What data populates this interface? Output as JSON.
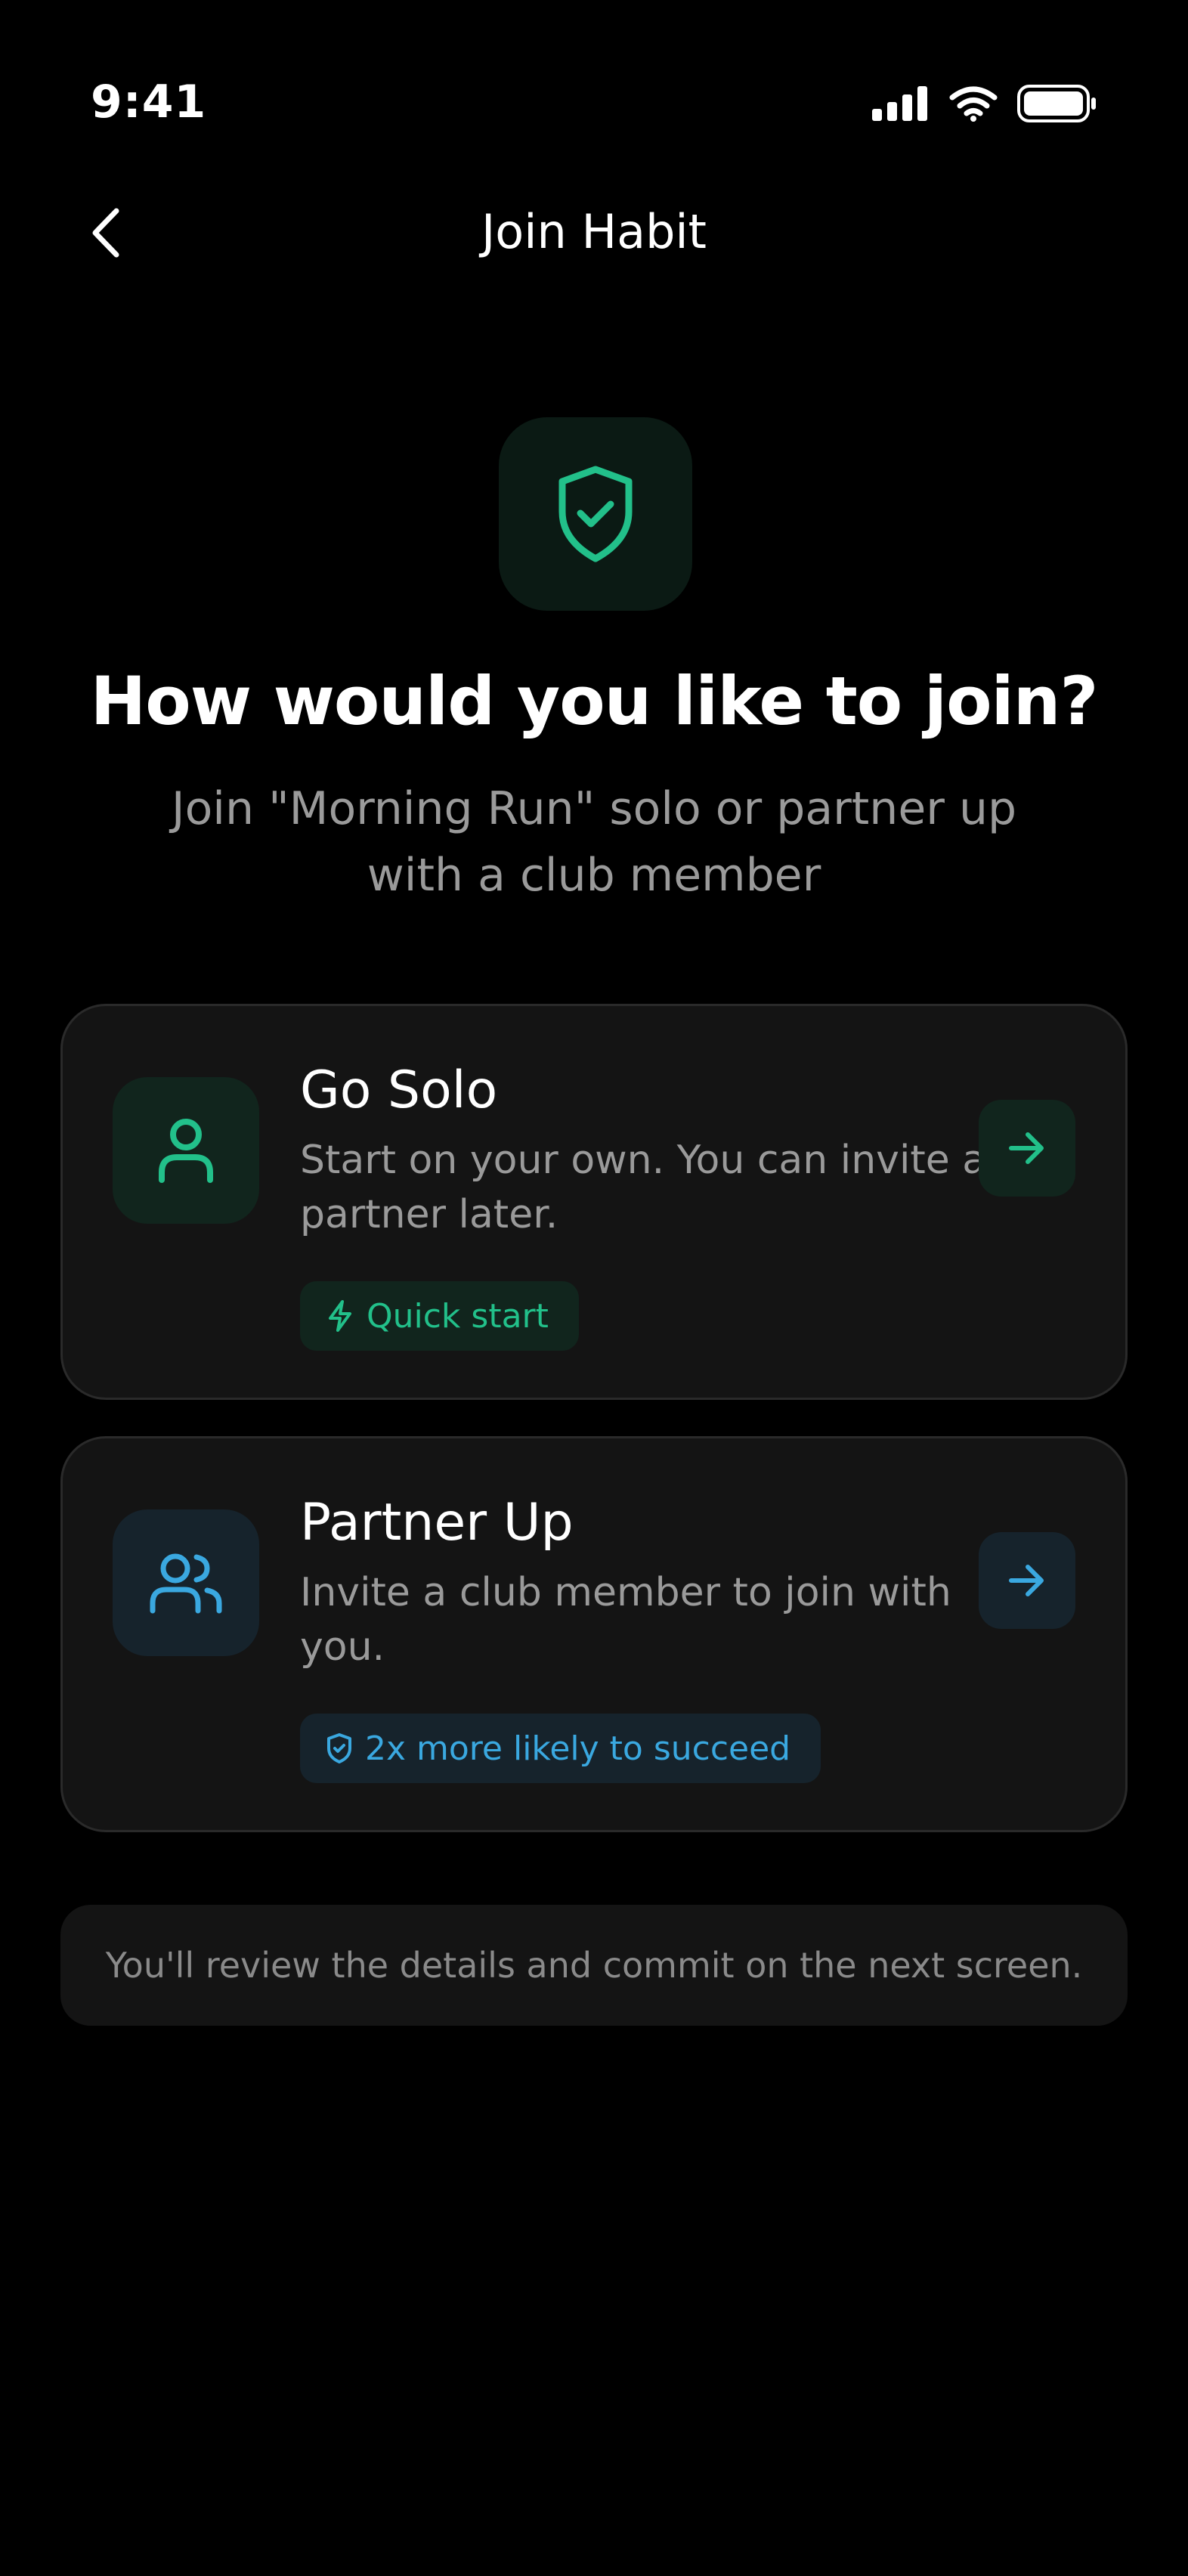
{
  "status_bar": {
    "time": "9:41",
    "icons": [
      "signal-icon",
      "wifi-icon",
      "battery-icon"
    ]
  },
  "nav": {
    "back_icon": "chevron-left-icon",
    "title": "Join Habit"
  },
  "hero": {
    "icon": "shield-check-icon",
    "heading": "How would you like to join?",
    "subheading": "Join \"Morning Run\" solo or partner up with a club member"
  },
  "options": [
    {
      "icon": "user-icon",
      "title": "Go Solo",
      "description": "Start on your own. You can invite a partner later.",
      "badge_icon": "lightning-icon",
      "badge": "Quick start",
      "arrow_icon": "arrow-right-icon",
      "accent": "#22c08a"
    },
    {
      "icon": "users-icon",
      "title": "Partner Up",
      "description": "Invite a club member to join with you.",
      "badge_icon": "shield-check-icon",
      "badge": "2x more likely to succeed",
      "arrow_icon": "arrow-right-icon",
      "accent": "#3aa8e0"
    }
  ],
  "note": "You'll review the details and commit on the next screen.",
  "colors": {
    "background": "#000000",
    "card": "#141414",
    "green_accent": "#22c08a",
    "blue_accent": "#3aa8e0",
    "muted_text": "#9a9a9a"
  }
}
